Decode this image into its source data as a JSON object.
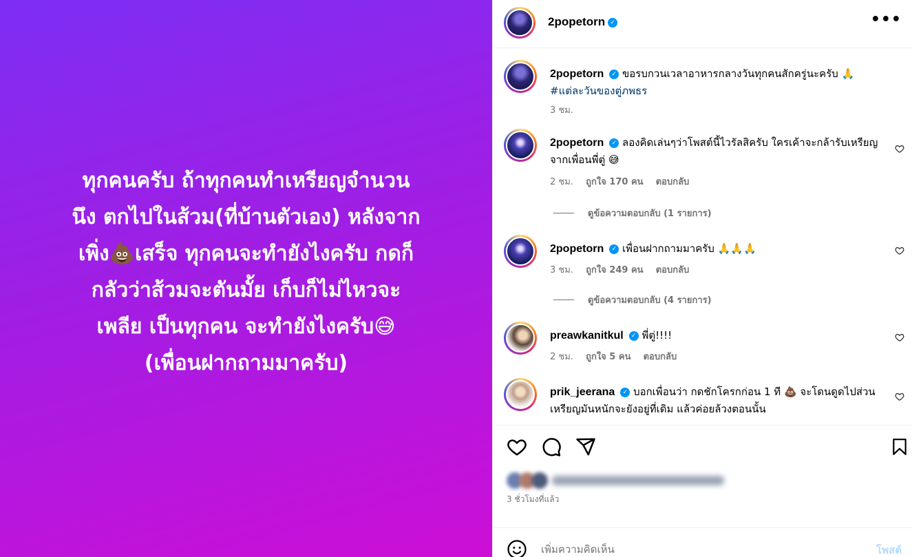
{
  "media": {
    "text": "ทุกคนครับ ถ้าทุกคนทำเหรียญจำนวน\nนึง ตกไปในส้วม(ที่บ้านตัวเอง) หลังจาก\nเพิ่ง💩เสร็จ ทุกคนจะทำยังไงครับ กดก็\nกลัวว่าส้วมจะตันมั้ย เก็บก็ไม่ไหวจะ\nเพลีย  เป็นทุกคน จะทำยังไงครับ😅\n(เพื่อนฝากถามมาครับ)"
  },
  "header": {
    "username": "2popetorn",
    "more_icon": "more-horizontal-icon"
  },
  "caption": {
    "username": "2popetorn",
    "text": "ขอรบกวนเวลาอาหารกลางวันทุกคนสักครู่นะครับ 🙏",
    "hashtag": "#แต่ละวันของตู่ภพธร",
    "time": "3 ชม."
  },
  "comments": [
    {
      "username": "2popetorn",
      "text": "ลองคิดเล่นๆว่าโพสต์นี้ไวรัลสิครับ ใครเค้าจะกล้ารับเหรียญจากเพื่อนพี่ตู่ 😅",
      "time": "2 ชม.",
      "likes": "ถูกใจ 170 คน",
      "reply": "ตอบกลับ",
      "view_replies": "ดูข้อความตอบกลับ (1 รายการ)"
    },
    {
      "username": "2popetorn",
      "text": "เพื่อนฝากถามมาครับ 🙏🙏🙏",
      "time": "3 ชม.",
      "likes": "ถูกใจ 249 คน",
      "reply": "ตอบกลับ",
      "view_replies": "ดูข้อความตอบกลับ (4 รายการ)"
    },
    {
      "username": "preawkanitkul",
      "text": "พี่ตู่!!!!",
      "time": "2 ชม.",
      "likes": "ถูกใจ 5 คน",
      "reply": "ตอบกลับ"
    },
    {
      "username": "prik_jeerana",
      "text": "บอกเพื่อนว่า กดชักโครกก่อน 1 ที 💩 จะโดนดูดไปส่วน เหรียญมันหนักจะยังอยู่ที่เดิม แล้วค่อยล้วงตอนนั้น"
    }
  ],
  "footer": {
    "timestamp": "3 ชั่วโมงที่แล้ว",
    "comment_placeholder": "เพิ่มความคิดเห็น",
    "post_label": "โพสต์"
  },
  "colors": {
    "gradient_start": "#7d2ef4",
    "gradient_end": "#cc0fd6",
    "verified": "#0095f6",
    "hashtag": "#00376b",
    "post_disabled": "#b3dbff"
  }
}
